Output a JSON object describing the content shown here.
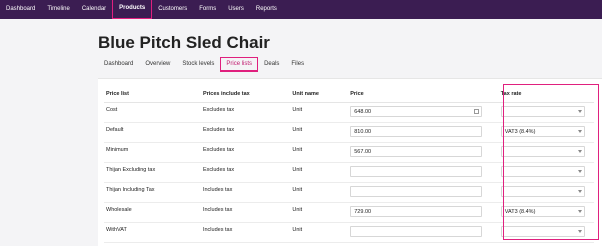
{
  "nav": {
    "items": [
      "Dashboard",
      "Timeline",
      "Calendar",
      "Products",
      "Customers",
      "Forms",
      "Users",
      "Reports"
    ],
    "active": "Products"
  },
  "page": {
    "title": "Blue Pitch Sled Chair"
  },
  "subtabs": {
    "items": [
      "Dashboard",
      "Overview",
      "Stock levels",
      "Price lists",
      "Deals",
      "Files"
    ],
    "active": "Price lists"
  },
  "table": {
    "headers": [
      "Price list",
      "Prices include tax",
      "Unit name",
      "Price",
      "Tax rate"
    ],
    "rows": [
      {
        "name": "Cost",
        "tax_mode": "Excludes tax",
        "unit": "Unit",
        "price": "648.00",
        "tax_rate": ""
      },
      {
        "name": "Default",
        "tax_mode": "Excludes tax",
        "unit": "Unit",
        "price": "810.00",
        "tax_rate": "VAT3 (8.4%)"
      },
      {
        "name": "Minimum",
        "tax_mode": "Excludes tax",
        "unit": "Unit",
        "price": "567.00",
        "tax_rate": ""
      },
      {
        "name": "Thijan Excluding tax",
        "tax_mode": "Excludes tax",
        "unit": "Unit",
        "price": "",
        "tax_rate": ""
      },
      {
        "name": "Thijan Including Tax",
        "tax_mode": "Includes tax",
        "unit": "Unit",
        "price": "",
        "tax_rate": ""
      },
      {
        "name": "Wholesale",
        "tax_mode": "Includes tax",
        "unit": "Unit",
        "price": "729.00",
        "tax_rate": "VAT3 (8.4%)"
      },
      {
        "name": "WithVAT",
        "tax_mode": "Includes tax",
        "unit": "Unit",
        "price": "",
        "tax_rate": ""
      }
    ]
  },
  "colors": {
    "nav_bg": "#3b1d52",
    "highlight": "#e0207e",
    "accent_text": "#c11a6e"
  },
  "icons": {
    "price_calc": "calculator-icon",
    "select_arrow": "chevron-down-icon"
  }
}
